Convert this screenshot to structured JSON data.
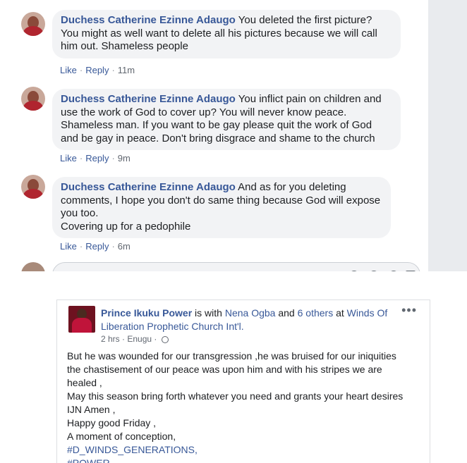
{
  "comments": [
    {
      "author": "Duchess Catherine Ezinne Adaugo",
      "text": " You deleted the first picture? You might as well want to delete all his pictures because we will call him out. Shameless people",
      "like": "Like",
      "reply": "Reply",
      "time": "11m"
    },
    {
      "author": "Duchess Catherine Ezinne Adaugo",
      "text": " You inflict pain on children and use the work of God to cover up? You will never know peace. Shameless man. If you want to be gay please quit the work of God and be gay in peace. Don't bring disgrace and shame to the church",
      "like": "Like",
      "reply": "Reply",
      "time": "9m"
    },
    {
      "author": "Duchess Catherine Ezinne Adaugo",
      "text": " And as for you deleting comments, I hope you don't do same thing because God will expose you too.",
      "text2": "Covering up for a pedophile",
      "like": "Like",
      "reply": "Reply",
      "time": "6m"
    }
  ],
  "post": {
    "author": "Prince Ikuku Power",
    "is_with": " is with ",
    "tagged": "Nena Ogba",
    "and": " and ",
    "others": "6 others",
    "at": " at ",
    "place": "Winds Of Liberation Prophetic Church Int'l.",
    "time": "2 hrs",
    "location": "Enugu",
    "more": "•••",
    "lines": [
      "But he was wounded for our transgression ,he was bruised for our iniquities",
      "the chastisement of our peace was upon him and with his stripes we are",
      "healed ,",
      "May this season bring forth whatever you need and grants your heart desires",
      "IJN Amen ,",
      "Happy good Friday ,",
      "A moment of conception,"
    ],
    "hashtags": [
      "#D_WINDS_GENERATIONS,",
      "#POWER"
    ]
  }
}
